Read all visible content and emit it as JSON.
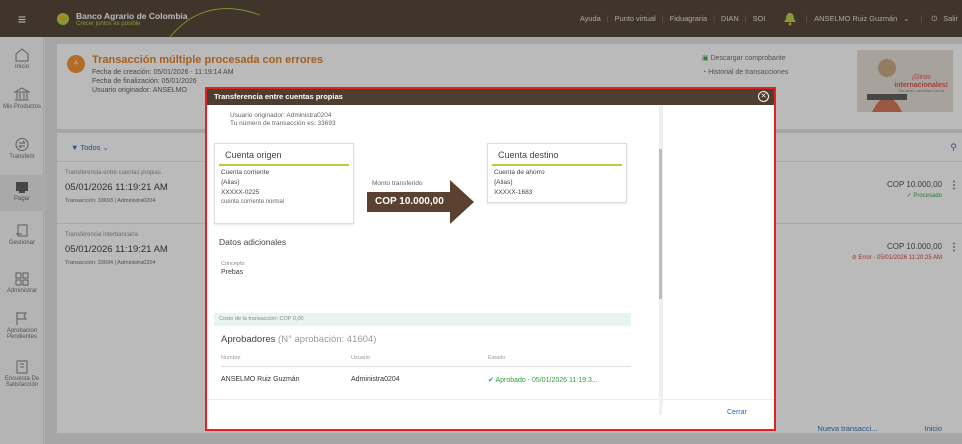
{
  "topbar": {
    "brand_name": "Banco Agrario de Colombia",
    "brand_tagline": "Crecer juntos es posible",
    "nav": [
      "Ayuda",
      "Punto virtual",
      "Fiduagraria",
      "DIAN",
      "SOI"
    ],
    "user": "ANSELMO Ruiz Guzmán",
    "logout": "Salir",
    "brand_color": "#4b3b2c",
    "accent_color": "#b8cf3b"
  },
  "sidebar": {
    "items": [
      {
        "label": "Inicio",
        "icon": "home-icon"
      },
      {
        "label": "Mis Productos",
        "icon": "bank-icon"
      },
      {
        "label": "Transferir",
        "icon": "transfer-icon"
      },
      {
        "label": "Pagar",
        "icon": "pay-icon"
      },
      {
        "label": "Gestionar",
        "icon": "manage-icon"
      },
      {
        "label": "Administrar",
        "icon": "grid-icon"
      },
      {
        "label": "Aprobacion Pendientes",
        "icon": "flag-icon"
      },
      {
        "label": "Encuesta De Satisfacción",
        "icon": "survey-icon"
      }
    ]
  },
  "header": {
    "title": "Transacción múltiple procesada con errores",
    "created": "Fecha de creación: 05/01/2026 - 11:19:14 AM",
    "finished": "Fecha de finalización: 05/01/2026",
    "originator": "Usuario originador: ANSELMO",
    "download": "Descargar comprobante",
    "history": "Historial de transacciones",
    "promo_line1": "¡Giros",
    "promo_line2": "internacionales!",
    "promo_line3": "Sin costo, sencillos con tu"
  },
  "filter": {
    "label": "Todos"
  },
  "transactions": [
    {
      "type": "Transferencia entre cuentas propias",
      "date": "05/01/2026 11:19:21 AM",
      "sub": "Transacción: 33693 | Administra0204",
      "amount": "COP 10.000,00",
      "status": "Procesado"
    },
    {
      "type": "Transferencia interbancaria",
      "date": "05/01/2026 11:19:21 AM",
      "sub": "Transacción: 33694 | Administra0204",
      "amount": "COP 10.000,00",
      "status": "Error - 05/01/2026 11:20:25 AM"
    }
  ],
  "footer": {
    "new_tx": "Nueva transacci...",
    "home": "Inicio"
  },
  "modal": {
    "title": "Transferencia entre cuentas propias",
    "originator": "Usuario originador: Administra0204",
    "tx_number": "Tu número de transacción es: 33693",
    "origin": {
      "title": "Cuenta origen",
      "type": "Cuenta corriente",
      "alias": "{Alias}",
      "number": "XXXXX-0225",
      "desc": "cuenta corriente normal"
    },
    "amount_label": "Monto transferido",
    "amount": "COP 10.000,00",
    "destination": {
      "title": "Cuenta destino",
      "type": "Cuenta de ahorro",
      "alias": "{Alias}",
      "number": "XXXXX-1683"
    },
    "extra_title": "Datos adicionales",
    "concept_label": "Concepto",
    "concept_value": "Prebas",
    "cost": "Costo de la transacción: COP 0,00",
    "approvers_title": "Aprobadores",
    "approvers_number": "(N° aprobación: 41604)",
    "columns": [
      "Nombre",
      "Usuario",
      "Estado"
    ],
    "approver": {
      "name": "ANSELMO Ruiz Guzmán",
      "user": "Administra0204",
      "status": "Aprobado - 05/01/2026 11:19:3..."
    },
    "close": "Cerrar"
  }
}
